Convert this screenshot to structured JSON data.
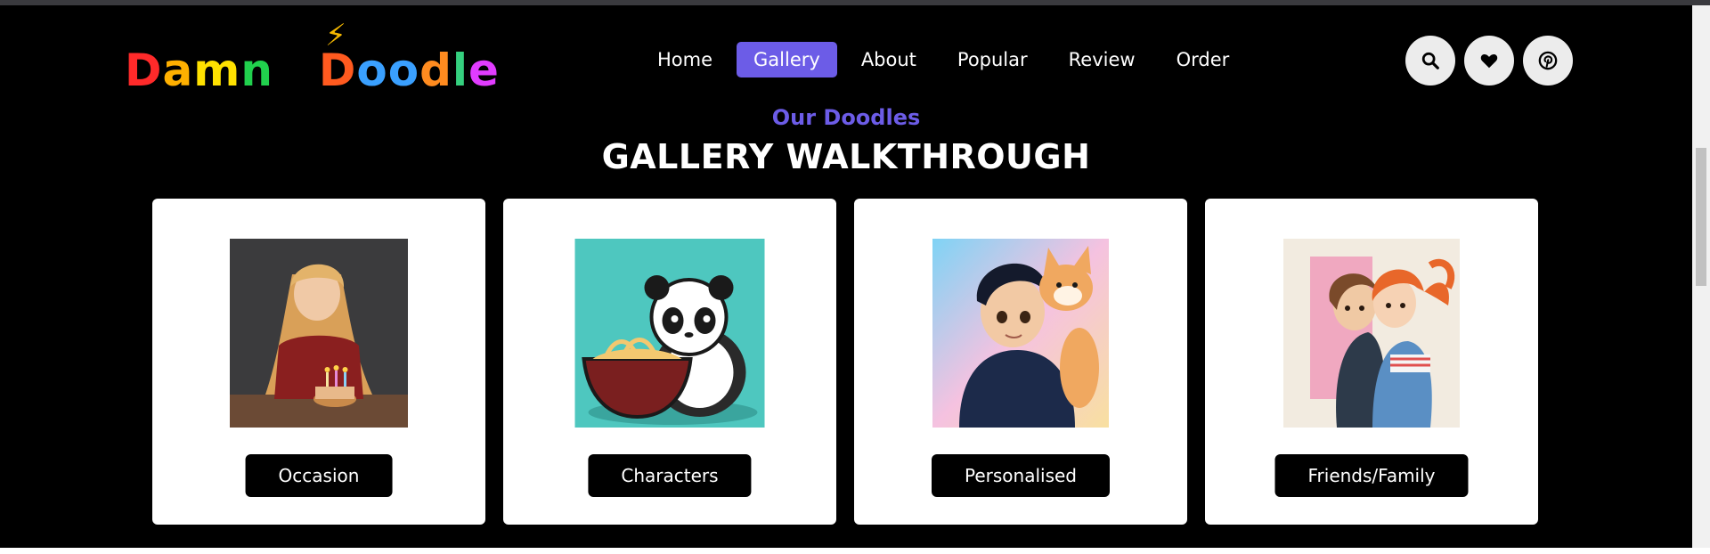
{
  "logo": {
    "text_part1": "Damn",
    "text_part2": "Doodle",
    "letters1": [
      {
        "ch": "D",
        "color": "#ff2a2a"
      },
      {
        "ch": "a",
        "color": "#ffb000"
      },
      {
        "ch": "m",
        "color": "#ffe100"
      },
      {
        "ch": "n",
        "color": "#21d04d"
      }
    ],
    "letters2": [
      {
        "ch": "D",
        "color": "#ff5a1f"
      },
      {
        "ch": "o",
        "color": "#3aa0ff"
      },
      {
        "ch": "o",
        "color": "#3aa0ff"
      },
      {
        "ch": "d",
        "color": "#ff8b1f"
      },
      {
        "ch": "l",
        "color": "#35d07f"
      },
      {
        "ch": "e",
        "color": "#e13cff"
      }
    ]
  },
  "nav": {
    "items": [
      {
        "label": "Home",
        "active": false
      },
      {
        "label": "Gallery",
        "active": true
      },
      {
        "label": "About",
        "active": false
      },
      {
        "label": "Popular",
        "active": false
      },
      {
        "label": "Review",
        "active": false
      },
      {
        "label": "Order",
        "active": false
      }
    ]
  },
  "header_icons": [
    "search-icon",
    "heart-icon",
    "pinterest-icon"
  ],
  "section": {
    "subtitle": "Our Doodles",
    "title": "GALLERY WALKTHROUGH"
  },
  "cards": [
    {
      "label": "Occasion",
      "image": "girl-with-birthday-cake-illustration"
    },
    {
      "label": "Characters",
      "image": "panda-eating-ramen-illustration"
    },
    {
      "label": "Personalised",
      "image": "boy-with-fox-illustration"
    },
    {
      "label": "Friends/Family",
      "image": "two-friends-hugging-illustration"
    }
  ],
  "colors": {
    "accent": "#6c5ce7",
    "background": "#000000",
    "card": "#ffffff"
  }
}
